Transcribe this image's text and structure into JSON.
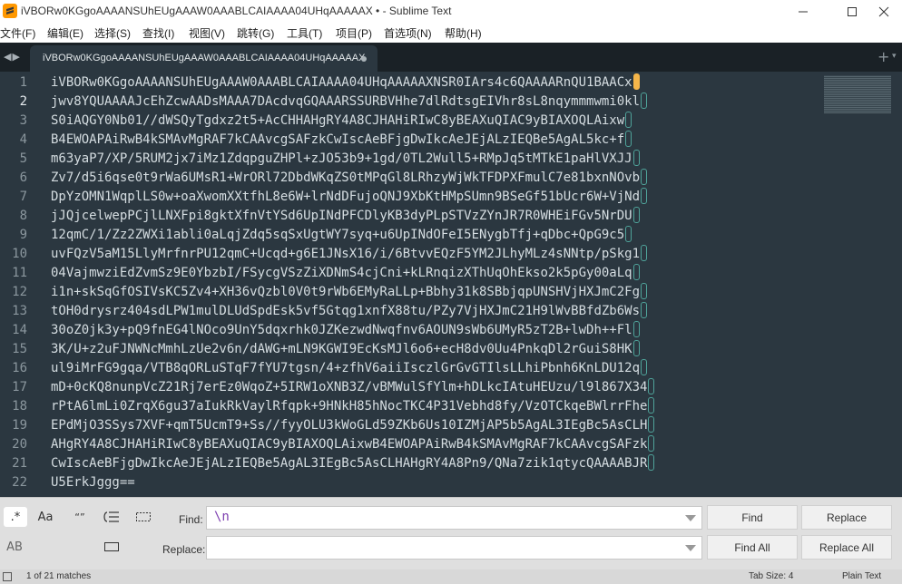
{
  "window": {
    "title": "iVBORw0KGgoAAAANSUhEUgAAAW0AAABLCAIAAAA04UHqAAAAAX • - Sublime Text"
  },
  "menu": [
    "文件(F)",
    "编辑(E)",
    "选择(S)",
    "查找(I)",
    "视图(V)",
    "跳转(G)",
    "工具(T)",
    "项目(P)",
    "首选项(N)",
    "帮助(H)"
  ],
  "tab": {
    "label": "iVBORw0KGgoAAAANSUhEUgAAAW0AAABLCAIAAAA04UHqAAAAAX",
    "modified": true
  },
  "editor": {
    "current_line": 2,
    "line_numbers": [
      "1",
      "2",
      "3",
      "4",
      "5",
      "6",
      "7",
      "8",
      "9",
      "10",
      "11",
      "12",
      "13",
      "14",
      "15",
      "16",
      "17",
      "18",
      "19",
      "20",
      "21",
      "22"
    ],
    "lines": [
      "iVBORw0KGgoAAAANSUhEUgAAAW0AAABLCAIAAAA04UHqAAAAAXNSR0IArs4c6QAAAARnQU1BAACx",
      "jwv8YQUAAAAJcEhZcwAADsMAAA7DAcdvqGQAAARSSURBVHhe7dlRdtsgEIVhr8sL8nqymmmwmi0kl",
      "S0iAQGY0Nb01//dWSQyTgdxz2t5+AcCHHAHgRY4A8CJHAHiRIwC8yBEAXuQIAC9yBIAXOQLAixw",
      "B4EWOAPAiRwB4kSMAvMgRAF7kCAAvcgSAFzkCwIscAeBFjgDwIkcAeJEjALzIEQBe5AgAL5kc+f",
      "m63yaP7/XP/5RUM2jx7iMz1ZdqpguZHPl+zJO53b9+1gd/0TL2Wull5+RMpJq5tMTkE1paHlVXJJ",
      "Zv7/d5i6qse0t9rWa6UMsR1+WrORl72DbdWKqZS0tMPqGl8LRhzyWjWkTFDPXFmulC7e81bxnNOvb",
      "DpYzOMN1WqplLS0w+oaXwomXXtfhL8e6W+lrNdDFujoQNJ9XbKtHMpSUmn9BSeGf51bUcr6W+VjNd",
      "jJQjcelwepPCjlLNXFpi8gktXfnVtYSd6UpINdPFCDlyKB3dyPLpSTVzZYnJR7R0WHEiFGv5NrDU",
      "12qmC/1/Zz2ZWXi1abli0aLqjZdq5sqSxUgtWY7syq+u6UpINdOFeI5ENygbTfj+qDbc+QpG9c5",
      "uvFQzV5aM15LlyMrfnrPU12qmC+Ucqd+g6E1JNsX16/i/6BtvvEQzF5YM2JLhyMLz4sNNtp/pSkg1",
      "04VajmwziEdZvmSz9E0YbzbI/FSycgVSzZiXDNmS4cjCni+kLRnqizXThUqOhEkso2k5pGy00aLq",
      "i1n+skSqGfOSIVsKC5Zv4+XH36vQzbl0V0t9rWb6EMyRaLLp+Bbhy31k8SBbjqpUNSHVjHXJmC2Fg",
      "tOH0drysrz404sdLPW1mulDLUdSpdEsk5vf5Gtqg1xnfX88tu/PZy7VjHXJmC21H9lWvBBfdZb6Ws",
      "30oZ0jk3y+pQ9fnEG4lNOco9UnY5dqxrhk0JZKezwdNwqfnv6AOUN9sWb6UMyR5zT2B+lwDh++Fl",
      "3K/U+z2uFJNWNcMmhLzUe2v6n/dAWG+mLN9KGWI9EcKsMJl6o6+ecH8dv0Uu4PnkqDl2rGuiS8HK",
      "ul9iMrFG9gqa/VTB8qORLuSTqF7fYU7tgsn/4+zfhV6aiiIsczlGrGvGTIlsLLhiPbnh6KnLDU12q",
      "mD+0cKQ8nunpVcZ21Rj7erEz0WqoZ+5IRW1oXNB3Z/vBMWulSfYlm+hDLkcIAtuHEUzu/l9l867X34",
      "rPtA6lmLi0ZrqX6gu37aIukRkVaylRfqpk+9HNkH85hNocTKC4P31Vebhd8fy/VzOTCkqeBWlrrFhe",
      "EPdMjO3SSys7XVF+qmT5UcmT9+Ss//fyyOLU3kWoGLd59ZKb6Us10IZMjAP5b5AgAL3IEgBc5AsCLH",
      "AHgRY4A8CJHAHiRIwC8yBEAXuQIAC9yBIAXOQLAixwB4EWOAPAiRwB4kSMAvMgRAF7kCAAvcgSAFzk",
      "CwIscAeBFjgDwIkcAeJEjALzIEQBe5AgAL3IEgBc5AsCLHAHgRY4A8Pn9/QNa7zik1qtycQAAAABJR",
      "U5ErkJggg=="
    ]
  },
  "find_panel": {
    "options": [
      "regex",
      "case",
      "whole-word",
      "wrap",
      "in-selection",
      "highlight"
    ],
    "find_label": "Find:",
    "find_value": "\\n",
    "replace_label": "Replace:",
    "replace_value": "",
    "buttons": {
      "find": "Find",
      "replace": "Replace",
      "find_all": "Find All",
      "replace_all": "Replace All"
    }
  },
  "status": {
    "matches": "1 of 21 matches",
    "tab_size": "Tab Size: 4",
    "syntax": "Plain Text"
  },
  "colors": {
    "editor_bg": "#2b3740",
    "tab_bar_bg": "#1a2126",
    "match_outline": "#4fa39a",
    "match_selected": "#f5b64a",
    "find_text": "#7d3fb0"
  }
}
